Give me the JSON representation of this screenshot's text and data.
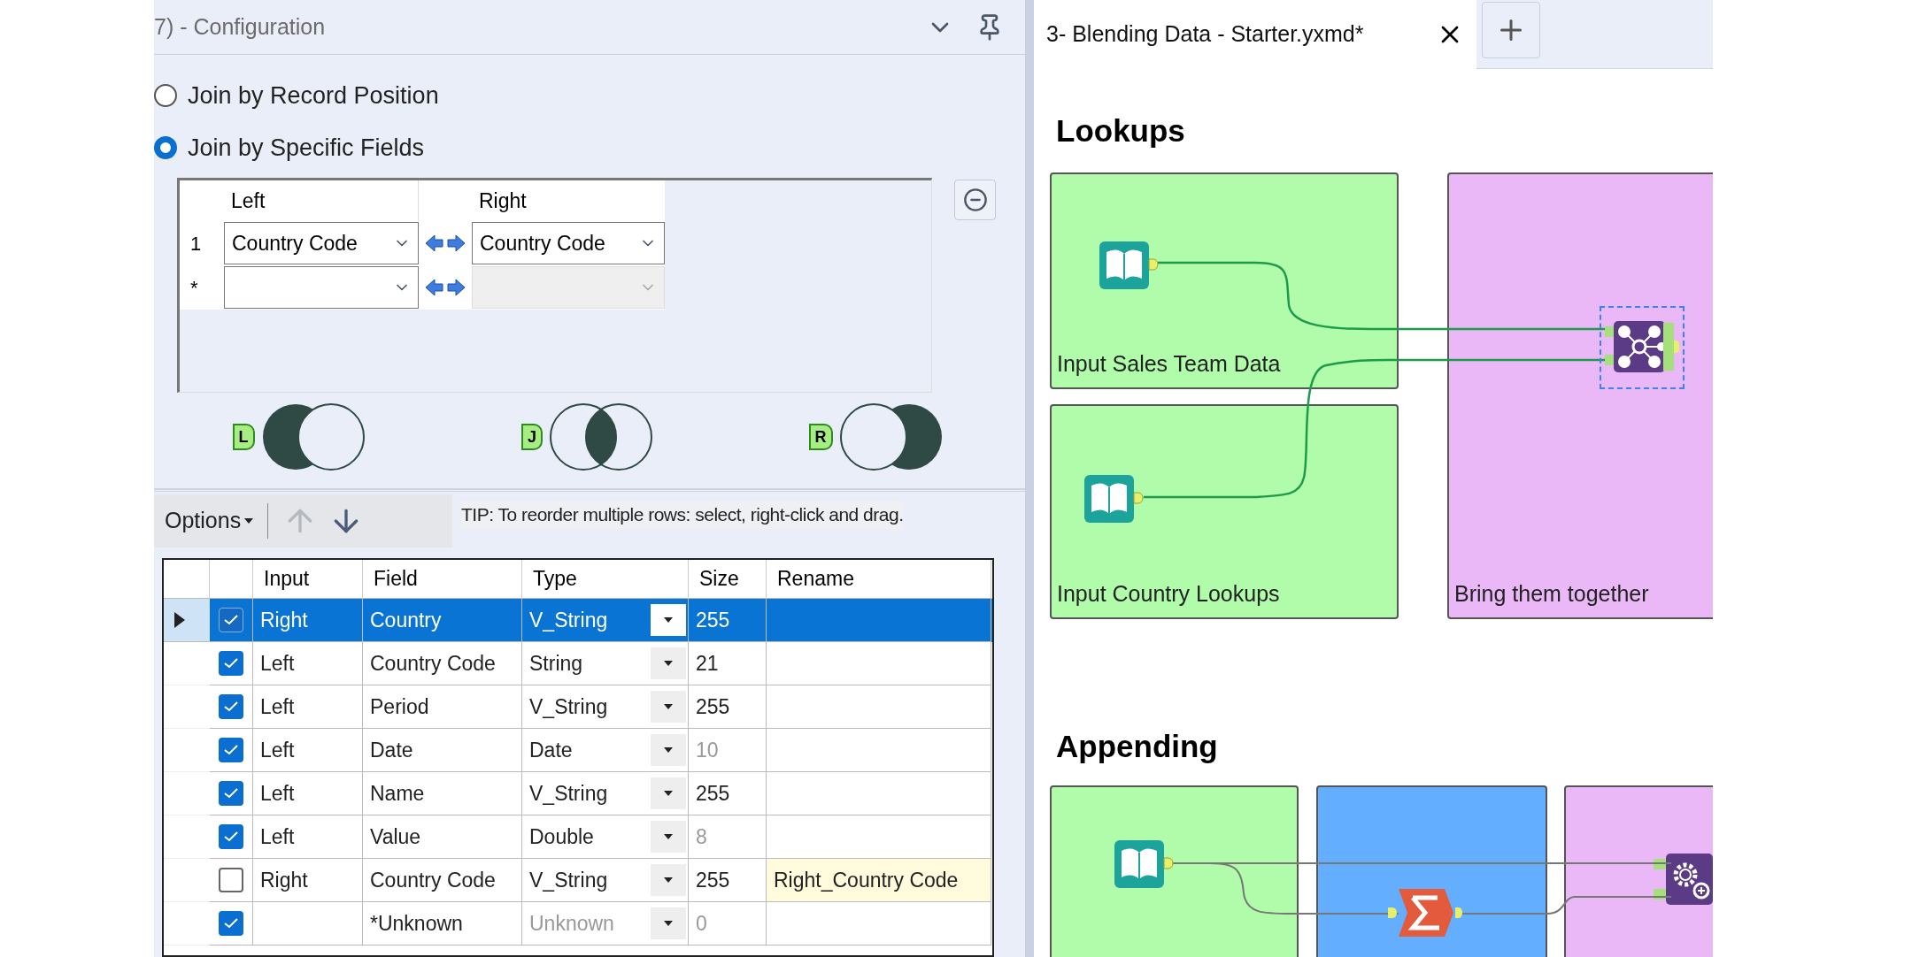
{
  "config_panel": {
    "title": "7) - Configuration",
    "join_modes": [
      {
        "label": "Join by Record Position",
        "selected": false
      },
      {
        "label": "Join by Specific Fields",
        "selected": true
      }
    ],
    "join_fields": {
      "columns": [
        "Left",
        "Right"
      ],
      "rows": [
        {
          "index": "1",
          "left": "Country Code",
          "right": "Country Code",
          "disabled": false
        },
        {
          "index": "*",
          "disabled": true
        }
      ]
    },
    "join_outputs": [
      {
        "label": "L",
        "kind": "left"
      },
      {
        "label": "J",
        "kind": "inner"
      },
      {
        "label": "R",
        "kind": "right"
      }
    ],
    "toolbar": {
      "options": "Options",
      "tip": "TIP: To reorder multiple rows: select, right-click and drag."
    },
    "field_table": {
      "columns": [
        "Input",
        "Field",
        "Type",
        "Size",
        "Rename"
      ],
      "rows": [
        {
          "selected": true,
          "checked": true,
          "input": "Right",
          "field": "Country",
          "type": "V_String",
          "size": "255",
          "size_dimmed": false,
          "type_dimmed": false
        },
        {
          "selected": false,
          "checked": true,
          "input": "Left",
          "field": "Country Code",
          "type": "String",
          "size": "21",
          "size_dimmed": false,
          "type_dimmed": false
        },
        {
          "selected": false,
          "checked": true,
          "input": "Left",
          "field": "Period",
          "type": "V_String",
          "size": "255",
          "size_dimmed": false,
          "type_dimmed": false
        },
        {
          "selected": false,
          "checked": true,
          "input": "Left",
          "field": "Date",
          "type": "Date",
          "size": "10",
          "size_dimmed": true,
          "type_dimmed": false
        },
        {
          "selected": false,
          "checked": true,
          "input": "Left",
          "field": "Name",
          "type": "V_String",
          "size": "255",
          "size_dimmed": false,
          "type_dimmed": false
        },
        {
          "selected": false,
          "checked": true,
          "input": "Left",
          "field": "Value",
          "type": "Double",
          "size": "8",
          "size_dimmed": true,
          "type_dimmed": false
        },
        {
          "selected": false,
          "checked": false,
          "input": "Right",
          "field": "Country Code",
          "type": "V_String",
          "size": "255",
          "rename": "Right_Country Code",
          "size_dimmed": false,
          "type_dimmed": false
        },
        {
          "selected": false,
          "checked": true,
          "field": "*Unknown",
          "type": "Unknown",
          "size": "0",
          "size_dimmed": true,
          "type_dimmed": true
        }
      ]
    }
  },
  "canvas": {
    "tab": {
      "title": "3- Blending Data - Starter.yxmd*"
    },
    "sections": [
      {
        "title": "Lookups"
      },
      {
        "title": "Appending"
      }
    ],
    "containers": [
      {
        "label": "Input Sales Team Data",
        "color": "#b0fcaa"
      },
      {
        "label": "Input Country Lookups",
        "color": "#b0fcaa"
      },
      {
        "label": "Bring them together",
        "color": "#eab8f7"
      },
      {
        "color": "#b0fcaa"
      },
      {
        "color": "#63aefe"
      },
      {
        "color": "#eab8f7"
      }
    ]
  }
}
